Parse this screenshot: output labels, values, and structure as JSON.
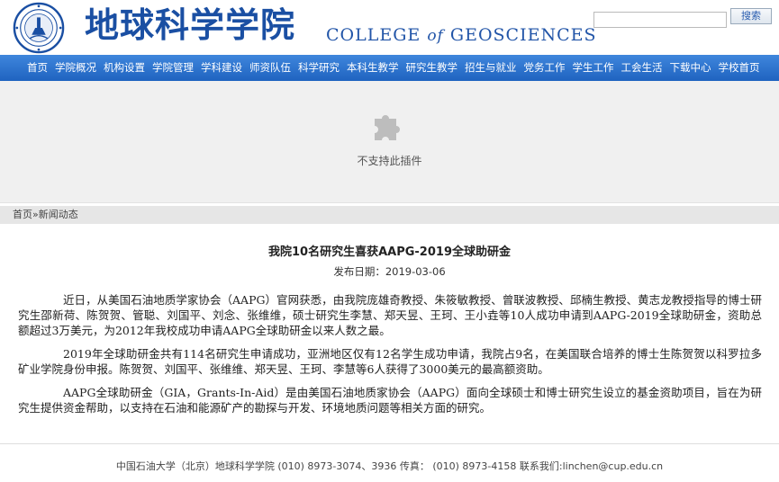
{
  "header": {
    "title_cn": "地球科学学院",
    "title_en_prefix": "COLLEGE",
    "title_en_of": "of",
    "title_en_suffix": "GEOSCIENCES",
    "brand_color": "#1a4fa3",
    "search": {
      "placeholder": "",
      "value": "",
      "button_label": "搜索"
    }
  },
  "nav": {
    "items": [
      "首页",
      "学院概况",
      "机构设置",
      "学院管理",
      "学科建设",
      "师资队伍",
      "科学研究",
      "本科生教学",
      "研究生教学",
      "招生与就业",
      "党务工作",
      "学生工作",
      "工会生活",
      "下载中心",
      "学校首页"
    ],
    "bg_color": "#2a6fcc"
  },
  "plugin": {
    "icon": "puzzle-piece-icon",
    "message": "不支持此插件"
  },
  "breadcrumb": {
    "home": "首页",
    "separator": "»",
    "current": "新闻动态"
  },
  "article": {
    "title": "我院10名研究生喜获AAPG-2019全球助研金",
    "date_label": "发布日期：",
    "date": "2019-03-06",
    "paragraphs": [
      "近日，从美国石油地质学家协会（AAPG）官网获悉，由我院庞雄奇教授、朱筱敏教授、曾联波教授、邱楠生教授、黄志龙教授指导的博士研究生邵新荷、陈贺贺、管聪、刘国平、刘念、张维维，硕士研究生李慧、郑天昱、王珂、王小垚等10人成功申请到AAPG-2019全球助研金，资助总额超过3万美元，为2012年我校成功申请AAPG全球助研金以来人数之最。",
      "2019年全球助研金共有114名研究生申请成功，亚洲地区仅有12名学生成功申请，我院占9名，在美国联合培养的博士生陈贺贺以科罗拉多矿业学院身份申报。陈贺贺、刘国平、张维维、郑天昱、王珂、李慧等6人获得了3000美元的最高额资助。",
      "AAPG全球助研金（GIA，Grants-In-Aid）是由美国石油地质家协会（AAPG）面向全球硕士和博士研究生设立的基金资助项目，旨在为研究生提供资金帮助，以支持在石油和能源矿产的勘探与开发、环境地质问题等相关方面的研究。"
    ]
  },
  "footer": {
    "text": "中国石油大学（北京）地球科学学院    (010) 8973-3074、3936 传真：  (010) 8973-4158 联系我们:linchen@cup.edu.cn"
  }
}
